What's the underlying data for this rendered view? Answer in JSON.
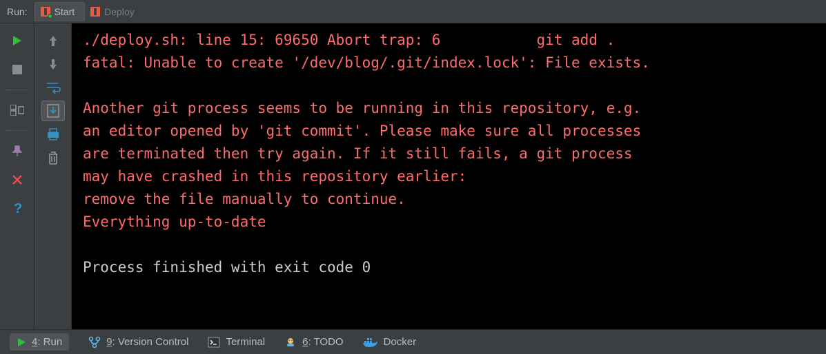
{
  "top": {
    "run_label": "Run:",
    "configs": [
      {
        "name": "Start",
        "active": true
      },
      {
        "name": "Deploy",
        "active": false
      }
    ]
  },
  "console": {
    "lines": [
      {
        "style": "err",
        "text": "./deploy.sh: line 15: 69650 Abort trap: 6           git add ."
      },
      {
        "style": "err",
        "text": "fatal: Unable to create '/dev/blog/.git/index.lock': File exists."
      },
      {
        "style": "blank",
        "text": " "
      },
      {
        "style": "err",
        "text": "Another git process seems to be running in this repository, e.g."
      },
      {
        "style": "err",
        "text": "an editor opened by 'git commit'. Please make sure all processes"
      },
      {
        "style": "err",
        "text": "are terminated then try again. If it still fails, a git process"
      },
      {
        "style": "err",
        "text": "may have crashed in this repository earlier:"
      },
      {
        "style": "err",
        "text": "remove the file manually to continue."
      },
      {
        "style": "err",
        "text": "Everything up-to-date"
      },
      {
        "style": "blank",
        "text": " "
      },
      {
        "style": "plain",
        "text": "Process finished with exit code 0"
      }
    ]
  },
  "bottom": {
    "run": {
      "mnemonic": "4",
      "rest": ": Run"
    },
    "vcs": {
      "mnemonic": "9",
      "rest": ": Version Control"
    },
    "terminal": {
      "label": "Terminal"
    },
    "todo": {
      "mnemonic": "6",
      "rest": ": TODO"
    },
    "docker": {
      "label": "Docker"
    }
  },
  "colors": {
    "error": "#ff6b6b",
    "plain": "#cccccc",
    "accent_green": "#2fbf3a",
    "accent_purple": "#9e7bb0",
    "accent_red": "#e84f4f",
    "accent_blue": "#3592c4"
  }
}
